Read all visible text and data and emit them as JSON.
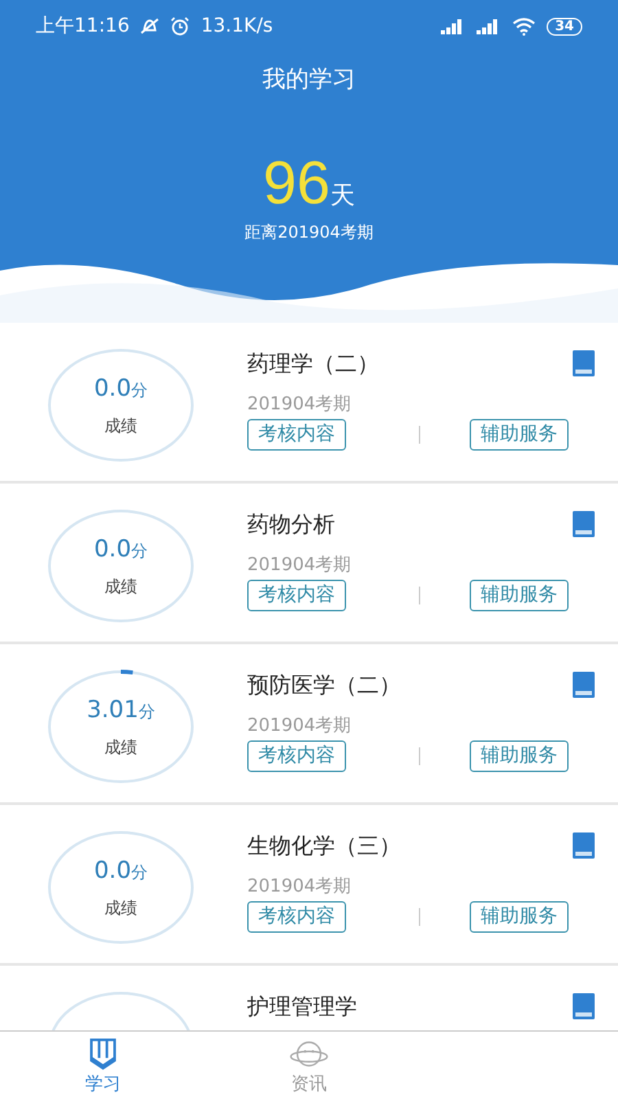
{
  "status_bar": {
    "time": "上午11:16",
    "speed": "13.1K/s",
    "battery": "34"
  },
  "header": {
    "title": "我的学习",
    "countdown": "96",
    "unit": "天",
    "caption": "距离201904考期"
  },
  "courses": [
    {
      "name": "药理学（二）",
      "period": "201904考期",
      "score": "0.0",
      "score_unit": "分",
      "score_label": "成绩",
      "buttons": [
        "考核内容",
        "辅助服务"
      ]
    },
    {
      "name": "药物分析",
      "period": "201904考期",
      "score": "0.0",
      "score_unit": "分",
      "score_label": "成绩",
      "buttons": [
        "考核内容",
        "辅助服务"
      ]
    },
    {
      "name": "预防医学（二）",
      "period": "201904考期",
      "score": "3.01",
      "score_unit": "分",
      "score_label": "成绩",
      "buttons": [
        "考核内容",
        "辅助服务"
      ]
    },
    {
      "name": "生物化学（三）",
      "period": "201904考期",
      "score": "0.0",
      "score_unit": "分",
      "score_label": "成绩",
      "buttons": [
        "考核内容",
        "辅助服务"
      ]
    },
    {
      "name": "护理管理学"
    }
  ],
  "tabs": [
    {
      "label": "学习",
      "kind": "study",
      "selected": true
    },
    {
      "label": "资讯",
      "kind": "news",
      "selected": false
    }
  ]
}
